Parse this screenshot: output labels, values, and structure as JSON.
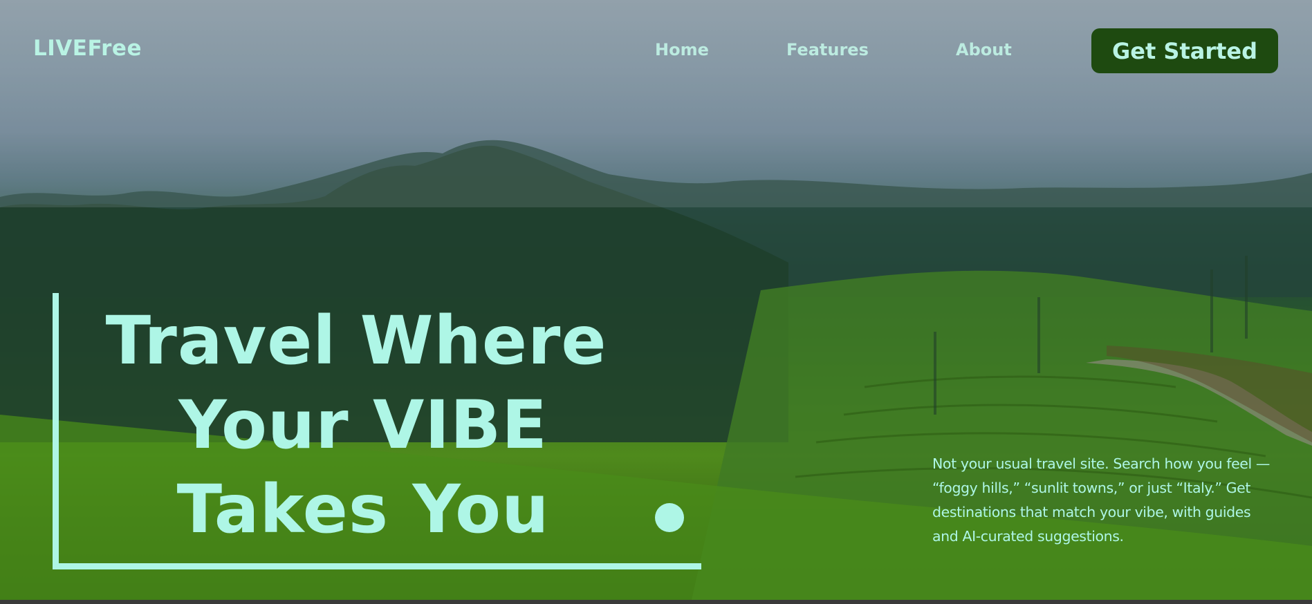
{
  "nav": {
    "logo": "LIVEFree",
    "links": [
      {
        "label": "Home"
      },
      {
        "label": "Features"
      },
      {
        "label": "About"
      }
    ],
    "cta_label": "Get Started"
  },
  "hero": {
    "headline_lines": [
      "Travel Where",
      "Your VIBE",
      "Takes You"
    ],
    "tagline": "Not your usual travel site. Search how you feel — “foggy hills,” “sunlit towns,” or just “Italy.” Get destinations that match your vibe, with guides and AI-curated suggestions."
  },
  "colors": {
    "accent": "#aef6e6",
    "cta_background": "#1e4a10"
  }
}
